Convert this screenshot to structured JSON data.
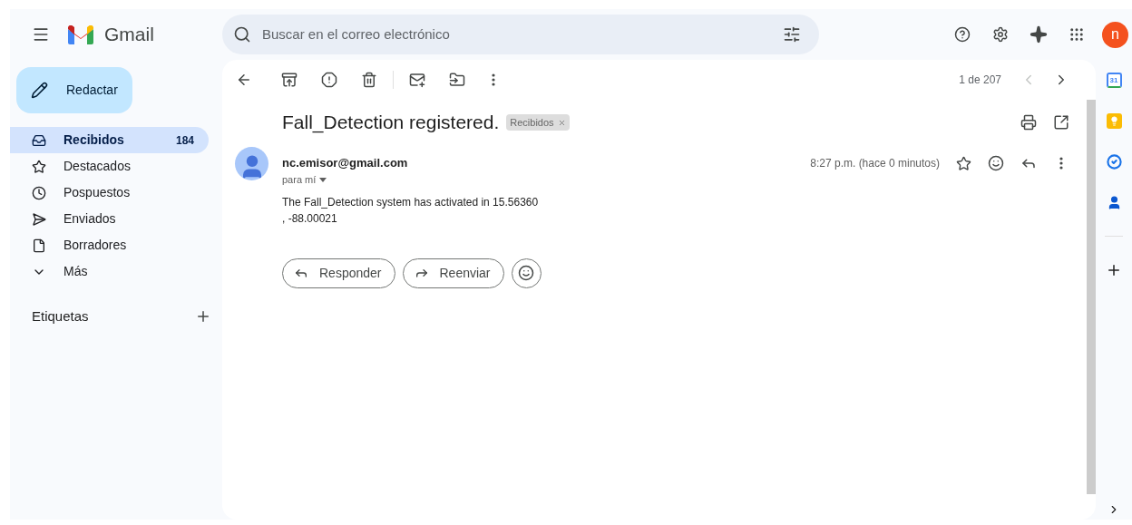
{
  "header": {
    "app_name": "Gmail",
    "search": {
      "placeholder": "Buscar en el correo electrónico"
    },
    "avatar_letter": "n"
  },
  "compose": {
    "label": "Redactar"
  },
  "sidebar": {
    "items": [
      {
        "label": "Recibidos",
        "count": "184",
        "selected": true
      },
      {
        "label": "Destacados",
        "selected": false
      },
      {
        "label": "Pospuestos",
        "selected": false
      },
      {
        "label": "Enviados",
        "selected": false
      },
      {
        "label": "Borradores",
        "selected": false
      },
      {
        "label": "Más",
        "selected": false
      }
    ],
    "labels_heading": "Etiquetas"
  },
  "toolbar": {
    "pagination": "1 de 207"
  },
  "message": {
    "subject": "Fall_Detection registered.",
    "label_chip": "Recibidos",
    "sender": "nc.emisor@gmail.com",
    "recipient": "para mí",
    "time": "8:27 p.m. (hace 0 minutos)",
    "body_lines": [
      "The Fall_Detection system has activated in 15.56360",
      ", -88.00021"
    ],
    "starred": false
  },
  "actions": [
    {
      "label": "Responder",
      "kind": "reply"
    },
    {
      "label": "Reenviar",
      "kind": "forward"
    }
  ],
  "side_rail": {
    "calendar_day": "31"
  }
}
